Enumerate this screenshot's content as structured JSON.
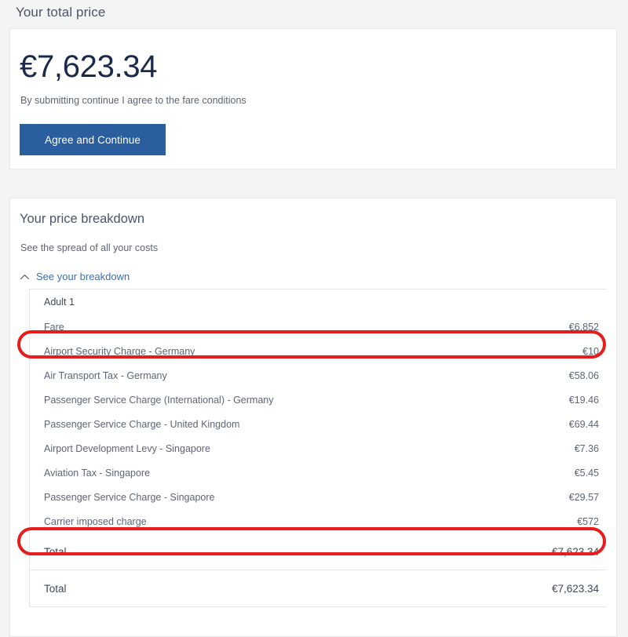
{
  "page": {
    "heading": "Your total price"
  },
  "total_card": {
    "amount": "€7,623.34",
    "fare_conditions_text": "By submitting continue I agree to the fare conditions",
    "agree_button_label": "Agree and Continue",
    "button_color": "#2a5e9e"
  },
  "breakdown_card": {
    "title": "Your price breakdown",
    "subtitle": "See the spread of all your costs",
    "toggle_label": "See your breakdown",
    "toggle_icon": "chevron-up-icon",
    "toggle_color": "#3d6fb0",
    "group_label": "Adult 1",
    "rows": [
      {
        "label": "Fare",
        "amount": "€6,852",
        "highlighted": true
      },
      {
        "label": "Airport Security Charge - Germany",
        "amount": "€10",
        "highlighted": false
      },
      {
        "label": "Air Transport Tax - Germany",
        "amount": "€58.06",
        "highlighted": false
      },
      {
        "label": "Passenger Service Charge (International) - Germany",
        "amount": "€19.46",
        "highlighted": false
      },
      {
        "label": "Passenger Service Charge - United Kingdom",
        "amount": "€69.44",
        "highlighted": false
      },
      {
        "label": "Airport Development Levy - Singapore",
        "amount": "€7.36",
        "highlighted": false
      },
      {
        "label": "Aviation Tax - Singapore",
        "amount": "€5.45",
        "highlighted": false
      },
      {
        "label": "Passenger Service Charge - Singapore",
        "amount": "€29.57",
        "highlighted": false
      },
      {
        "label": "Carrier imposed charge",
        "amount": "€572",
        "highlighted": true
      }
    ],
    "totals": [
      {
        "label": "Total",
        "amount": "€7,623.34"
      },
      {
        "label": "Total",
        "amount": "€7,623.34"
      }
    ]
  },
  "annotations": {
    "highlight_color": "#e81c1c",
    "highlighted_rows": [
      "Fare",
      "Carrier imposed charge"
    ]
  }
}
